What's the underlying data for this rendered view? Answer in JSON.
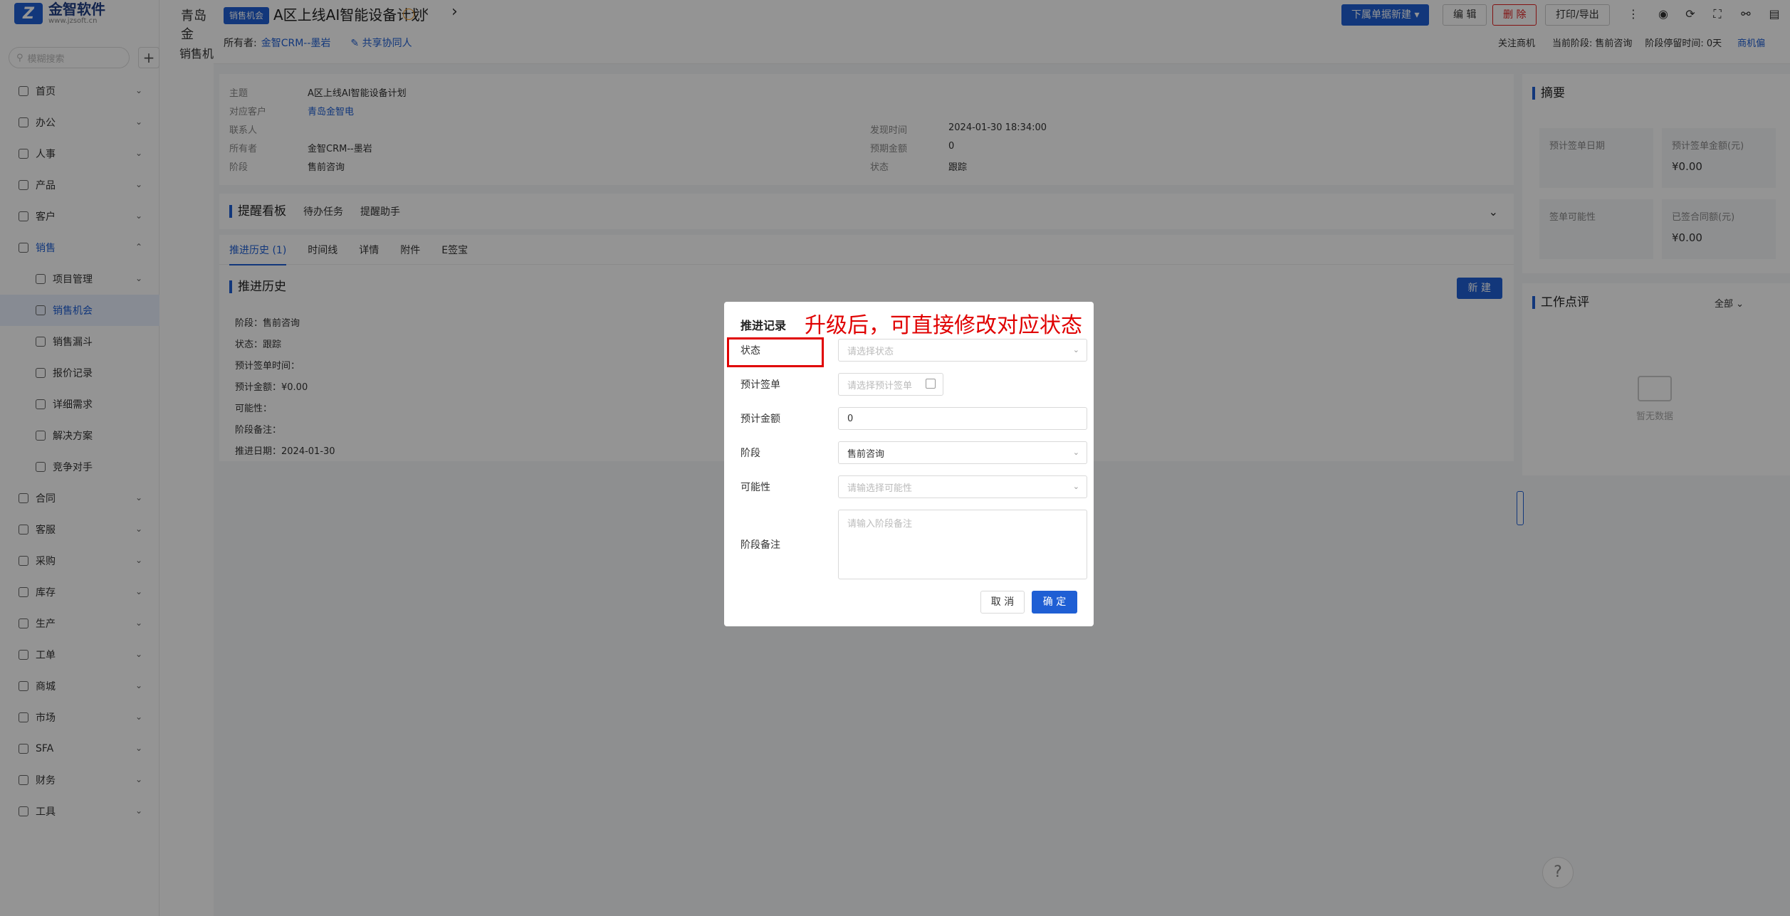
{
  "logo": {
    "mark": "Z",
    "name": "金智软件",
    "url": "www.jzsoft.cn"
  },
  "sidebar": {
    "search_placeholder": "模糊搜索",
    "items": [
      {
        "label": "首页",
        "type": "top"
      },
      {
        "label": "办公",
        "type": "top"
      },
      {
        "label": "人事",
        "type": "top"
      },
      {
        "label": "产品",
        "type": "top"
      },
      {
        "label": "客户",
        "type": "top"
      },
      {
        "label": "销售",
        "type": "open"
      },
      {
        "label": "项目管理",
        "type": "sub"
      },
      {
        "label": "销售机会",
        "type": "active"
      },
      {
        "label": "销售漏斗",
        "type": "sub"
      },
      {
        "label": "报价记录",
        "type": "sub"
      },
      {
        "label": "详细需求",
        "type": "sub"
      },
      {
        "label": "解决方案",
        "type": "sub"
      },
      {
        "label": "竞争对手",
        "type": "sub"
      },
      {
        "label": "合同",
        "type": "top"
      },
      {
        "label": "客服",
        "type": "top"
      },
      {
        "label": "采购",
        "type": "top"
      },
      {
        "label": "库存",
        "type": "top"
      },
      {
        "label": "生产",
        "type": "top"
      },
      {
        "label": "工单",
        "type": "top"
      },
      {
        "label": "商城",
        "type": "top"
      },
      {
        "label": "市场",
        "type": "top"
      },
      {
        "label": "SFA",
        "type": "top"
      },
      {
        "label": "财务",
        "type": "top"
      },
      {
        "label": "工具",
        "type": "top"
      }
    ]
  },
  "list_col": {
    "head1": "青岛金",
    "head2": "销售机"
  },
  "topbar": {
    "tag": "销售机会",
    "title": "A区上线AI智能设备计划",
    "owner_label": "所有者:",
    "owner_value": "金智CRM--墨岩",
    "share": "共享协同人",
    "btn_dropdown": "下属单据新建",
    "btn_edit": "编 辑",
    "btn_delete": "删 除",
    "btn_print": "打印/导出",
    "follow": "关注商机",
    "stage_label": "当前阶段:",
    "stage_value": "售前咨询",
    "stay_label": "阶段停留时间:",
    "stay_value": "0天",
    "more_link": "商机偏"
  },
  "info": {
    "subject_k": "主题",
    "subject_v": "A区上线AI智能设备计划",
    "customer_k": "对应客户",
    "customer_v": "青岛金智电",
    "contact_k": "联系人",
    "owner_k": "所有者",
    "owner_v": "金智CRM--墨岩",
    "stage_k": "阶段",
    "stage_v": "售前咨询",
    "found_k": "发现时间",
    "found_v": "2024-01-30 18:34:00",
    "amount_k": "预期金额",
    "amount_v": "0",
    "status_k": "状态",
    "status_v": "跟踪"
  },
  "remind": {
    "title": "提醒看板",
    "tab1": "待办任务",
    "tab2": "提醒助手"
  },
  "tabs": {
    "t1": "推进历史 (1)",
    "t2": "时间线",
    "t3": "详情",
    "t4": "附件",
    "t5": "E签宝"
  },
  "history": {
    "title": "推进历史",
    "new_btn": "新 建",
    "lines": [
      "阶段：售前咨询",
      "状态：跟踪",
      "预计签单时间：",
      "预计金额：¥0.00",
      "可能性：",
      "阶段备注：",
      "推进日期：2024-01-30"
    ]
  },
  "summary": {
    "title": "摘要",
    "t1": "预计签单日期",
    "t2": "预计签单金额(元)",
    "t2v": "¥0.00",
    "t3": "签单可能性",
    "t4": "已签合同额(元)",
    "t4v": "¥0.00"
  },
  "work": {
    "title": "工作点评",
    "filter": "全部",
    "empty": "暂无数据"
  },
  "modal": {
    "title": "推进记录",
    "annotation": "升级后，可直接修改对应状态",
    "status_label": "状态",
    "status_placeholder": "请选择状态",
    "date_label": "预计签单",
    "date_placeholder": "请选择预计签单",
    "amount_label": "预计金额",
    "amount_value": "0",
    "stage_label": "阶段",
    "stage_value": "售前咨询",
    "prob_label": "可能性",
    "prob_placeholder": "请输选择可能性",
    "note_label": "阶段备注",
    "note_placeholder": "请输入阶段备注",
    "cancel": "取 消",
    "ok": "确 定"
  },
  "colors": {
    "accent": "#1f5fd4",
    "danger": "#e00000",
    "overlay": "rgba(0,0,0,0.42)"
  }
}
